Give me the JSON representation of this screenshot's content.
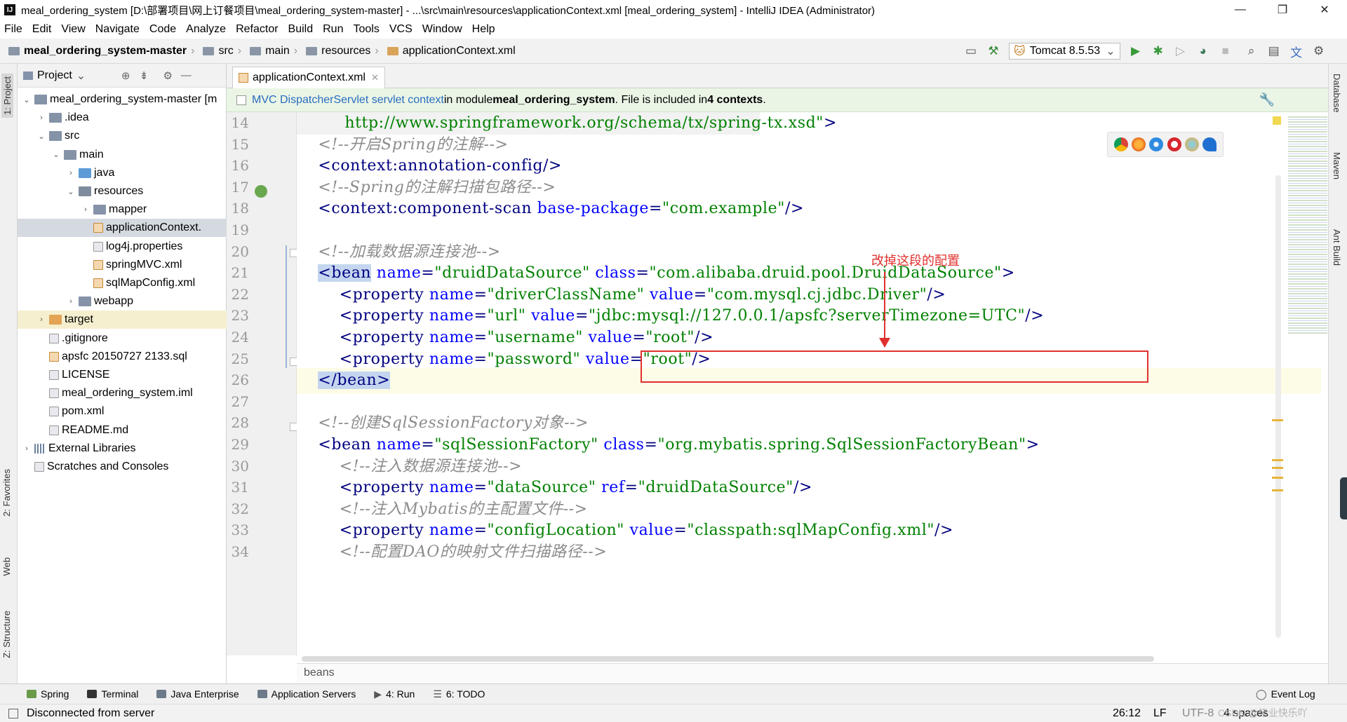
{
  "title": "meal_ordering_system [D:\\部署项目\\网上订餐项目\\meal_ordering_system-master] - ...\\src\\main\\resources\\applicationContext.xml [meal_ordering_system] - IntelliJ IDEA (Administrator)",
  "menu": [
    "File",
    "Edit",
    "View",
    "Navigate",
    "Code",
    "Analyze",
    "Refactor",
    "Build",
    "Run",
    "Tools",
    "VCS",
    "Window",
    "Help"
  ],
  "breadcrumb": [
    "meal_ordering_system-master",
    "src",
    "main",
    "resources",
    "applicationContext.xml"
  ],
  "run_config": "Tomcat 8.5.53",
  "project_panel": {
    "header": "Project",
    "tree": [
      {
        "label": "meal_ordering_system-master [m",
        "depth": 0,
        "arrow": "▾",
        "icon": "f-dir",
        "bold": false
      },
      {
        "label": ".idea",
        "depth": 1,
        "arrow": "▸",
        "icon": "f-dir"
      },
      {
        "label": "src",
        "depth": 1,
        "arrow": "▾",
        "icon": "f-dir"
      },
      {
        "label": "main",
        "depth": 2,
        "arrow": "▾",
        "icon": "f-dir"
      },
      {
        "label": "java",
        "depth": 3,
        "arrow": "▸",
        "icon": "f-src"
      },
      {
        "label": "resources",
        "depth": 3,
        "arrow": "▾",
        "icon": "f-res"
      },
      {
        "label": "mapper",
        "depth": 4,
        "arrow": "▸",
        "icon": "f-dir"
      },
      {
        "label": "applicationContext.",
        "depth": 4,
        "arrow": "",
        "icon": "f-xml",
        "state": "sel"
      },
      {
        "label": "log4j.properties",
        "depth": 4,
        "arrow": "",
        "icon": "f-doc"
      },
      {
        "label": "springMVC.xml",
        "depth": 4,
        "arrow": "",
        "icon": "f-xml"
      },
      {
        "label": "sqlMapConfig.xml",
        "depth": 4,
        "arrow": "",
        "icon": "f-xml"
      },
      {
        "label": "webapp",
        "depth": 3,
        "arrow": "▸",
        "icon": "f-dir"
      },
      {
        "label": "target",
        "depth": 1,
        "arrow": "▸",
        "icon": "f-ora",
        "state": "hl"
      },
      {
        "label": ".gitignore",
        "depth": 1,
        "arrow": "",
        "icon": "f-doc"
      },
      {
        "label": "apsfc 20150727 2133.sql",
        "depth": 1,
        "arrow": "",
        "icon": "f-xml"
      },
      {
        "label": "LICENSE",
        "depth": 1,
        "arrow": "",
        "icon": "f-doc"
      },
      {
        "label": "meal_ordering_system.iml",
        "depth": 1,
        "arrow": "",
        "icon": "f-doc"
      },
      {
        "label": "pom.xml",
        "depth": 1,
        "arrow": "",
        "icon": "f-doc"
      },
      {
        "label": "README.md",
        "depth": 1,
        "arrow": "",
        "icon": "f-doc"
      },
      {
        "label": "External Libraries",
        "depth": 0,
        "arrow": "▸",
        "icon": "f-lib"
      },
      {
        "label": "Scratches and Consoles",
        "depth": 0,
        "arrow": "",
        "icon": "f-doc"
      }
    ]
  },
  "left_tabs": [
    "1: Project",
    "2: Favorites",
    "Web",
    "Z: Structure"
  ],
  "right_tabs": [
    "Database",
    "Maven",
    "Ant Build"
  ],
  "editor_tab": "applicationContext.xml",
  "banner": {
    "link": "MVC DispatcherServlet servlet context",
    "text1": " in module ",
    "module": "meal_ordering_system",
    "text2": ". File is included in ",
    "contexts": "4 contexts",
    "text3": "."
  },
  "code_lines": [
    {
      "n": "14",
      "segs": [
        [
          "         ",
          "bk"
        ],
        [
          "http://www.springframework.org/schema/tx/spring-tx.xsd\"",
          "v"
        ],
        [
          ">",
          "t"
        ]
      ]
    },
    {
      "n": "15",
      "segs": [
        [
          "    ",
          "bk"
        ],
        [
          "<!--开启Spring的注解-->",
          "c"
        ]
      ]
    },
    {
      "n": "16",
      "segs": [
        [
          "    ",
          "bk"
        ],
        [
          "<context:annotation-config/>",
          "t"
        ]
      ]
    },
    {
      "n": "17",
      "segs": [
        [
          "    ",
          "bk"
        ],
        [
          "<!--Spring的注解扫描包路径-->",
          "c"
        ]
      ]
    },
    {
      "n": "18",
      "segs": [
        [
          "    ",
          "bk"
        ],
        [
          "<context:component-scan ",
          "t"
        ],
        [
          "base-package",
          "a"
        ],
        [
          "=",
          "t"
        ],
        [
          "\"com.example\"",
          "v"
        ],
        [
          "/>",
          "t"
        ]
      ]
    },
    {
      "n": "19",
      "segs": [
        [
          "",
          "bk"
        ]
      ]
    },
    {
      "n": "20",
      "segs": [
        [
          "    ",
          "bk"
        ],
        [
          "<!--加载数据源连接池-->",
          "c"
        ]
      ]
    },
    {
      "n": "21",
      "segs": [
        [
          "    ",
          "bk"
        ],
        [
          "<bean",
          "t mb"
        ],
        [
          " name",
          "a"
        ],
        [
          "=",
          "t"
        ],
        [
          "\"druidDataSource\"",
          "v"
        ],
        [
          " class",
          "a"
        ],
        [
          "=",
          "t"
        ],
        [
          "\"com.alibaba.druid.pool.DruidDataSource\"",
          "v"
        ],
        [
          ">",
          "t"
        ]
      ]
    },
    {
      "n": "22",
      "segs": [
        [
          "        ",
          "bk"
        ],
        [
          "<property ",
          "t"
        ],
        [
          "name",
          "a"
        ],
        [
          "=",
          "t"
        ],
        [
          "\"driverClassName\"",
          "v"
        ],
        [
          " value",
          "a"
        ],
        [
          "=",
          "t"
        ],
        [
          "\"com.mysql.cj.jdbc.Driver\"",
          "v"
        ],
        [
          "/>",
          "t"
        ]
      ]
    },
    {
      "n": "23",
      "segs": [
        [
          "        ",
          "bk"
        ],
        [
          "<property ",
          "t"
        ],
        [
          "name",
          "a"
        ],
        [
          "=",
          "t"
        ],
        [
          "\"url\"",
          "v"
        ],
        [
          " value",
          "a"
        ],
        [
          "=",
          "t"
        ],
        [
          "\"jdbc:mysql://127.0.0.1/apsfc?serverTimezone=UTC\"",
          "v"
        ],
        [
          "/>",
          "t"
        ]
      ]
    },
    {
      "n": "24",
      "segs": [
        [
          "        ",
          "bk"
        ],
        [
          "<property ",
          "t"
        ],
        [
          "name",
          "a"
        ],
        [
          "=",
          "t"
        ],
        [
          "\"username\"",
          "v"
        ],
        [
          " value",
          "a"
        ],
        [
          "=",
          "t"
        ],
        [
          "\"root\"",
          "v"
        ],
        [
          "/>",
          "t"
        ]
      ]
    },
    {
      "n": "25",
      "segs": [
        [
          "        ",
          "bk"
        ],
        [
          "<property ",
          "t"
        ],
        [
          "name",
          "a"
        ],
        [
          "=",
          "t"
        ],
        [
          "\"password\"",
          "v"
        ],
        [
          " value",
          "a"
        ],
        [
          "=",
          "t"
        ],
        [
          "\"root\"",
          "v"
        ],
        [
          "/>",
          "t"
        ]
      ]
    },
    {
      "n": "26",
      "segs": [
        [
          "    ",
          "bk"
        ],
        [
          "</bean>",
          "t mb"
        ]
      ]
    },
    {
      "n": "27",
      "segs": [
        [
          "",
          "bk"
        ]
      ]
    },
    {
      "n": "28",
      "segs": [
        [
          "    ",
          "bk"
        ],
        [
          "<!--创建SqlSessionFactory对象-->",
          "c"
        ]
      ]
    },
    {
      "n": "29",
      "segs": [
        [
          "    ",
          "bk"
        ],
        [
          "<bean ",
          "t"
        ],
        [
          "name",
          "a"
        ],
        [
          "=",
          "t"
        ],
        [
          "\"sqlSessionFactory\"",
          "v"
        ],
        [
          " class",
          "a"
        ],
        [
          "=",
          "t"
        ],
        [
          "\"org.mybatis.spring.SqlSessionFactoryBean\"",
          "v"
        ],
        [
          ">",
          "t"
        ]
      ]
    },
    {
      "n": "30",
      "segs": [
        [
          "        ",
          "bk"
        ],
        [
          "<!--注入数据源连接池-->",
          "c"
        ]
      ]
    },
    {
      "n": "31",
      "segs": [
        [
          "        ",
          "bk"
        ],
        [
          "<property ",
          "t"
        ],
        [
          "name",
          "a"
        ],
        [
          "=",
          "t"
        ],
        [
          "\"dataSource\"",
          "v"
        ],
        [
          " ref",
          "a"
        ],
        [
          "=",
          "t"
        ],
        [
          "\"druidDataSource\"",
          "v"
        ],
        [
          "/>",
          "t"
        ]
      ]
    },
    {
      "n": "32",
      "segs": [
        [
          "        ",
          "bk"
        ],
        [
          "<!--注入Mybatis的主配置文件-->",
          "c"
        ]
      ]
    },
    {
      "n": "33",
      "segs": [
        [
          "        ",
          "bk"
        ],
        [
          "<property ",
          "t"
        ],
        [
          "name",
          "a"
        ],
        [
          "=",
          "t"
        ],
        [
          "\"configLocation\"",
          "v"
        ],
        [
          " value",
          "a"
        ],
        [
          "=",
          "t"
        ],
        [
          "\"classpath:sqlMapConfig.xml\"",
          "v"
        ],
        [
          "/>",
          "t"
        ]
      ]
    },
    {
      "n": "34",
      "segs": [
        [
          "        ",
          "bk"
        ],
        [
          "<!--配置DAO的映射文件扫描路径-->",
          "c"
        ]
      ]
    }
  ],
  "annotation": "改掉这段的配置",
  "editor_breadcrumb": "beans",
  "bottom_tabs": [
    "Spring",
    "Terminal",
    "Java Enterprise",
    "Application Servers",
    "4: Run",
    "6: TODO"
  ],
  "event_log": "Event Log",
  "status": {
    "message": "Disconnected from server",
    "position": "26:12",
    "line_sep": "LF",
    "encoding": "UTF-8",
    "indent": "4 spaces",
    "watermark": "CSDN @毕业快乐吖"
  },
  "colors": {
    "tag": "#000080",
    "attr": "#0000ff",
    "value": "#008000",
    "comment": "#8c8c8c",
    "annotation": "#e0302e"
  }
}
